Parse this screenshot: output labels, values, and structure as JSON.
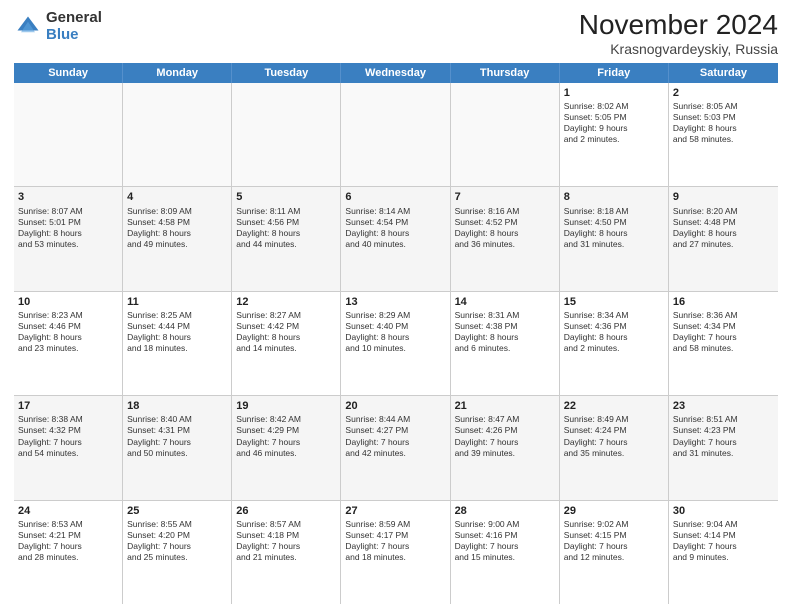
{
  "header": {
    "logo_general": "General",
    "logo_blue": "Blue",
    "title": "November 2024",
    "subtitle": "Krasnogvardeyskiy, Russia"
  },
  "days": [
    "Sunday",
    "Monday",
    "Tuesday",
    "Wednesday",
    "Thursday",
    "Friday",
    "Saturday"
  ],
  "weeks": [
    [
      {
        "day": "",
        "empty": true
      },
      {
        "day": "",
        "empty": true
      },
      {
        "day": "",
        "empty": true
      },
      {
        "day": "",
        "empty": true
      },
      {
        "day": "",
        "empty": true
      },
      {
        "day": "1",
        "lines": [
          "Sunrise: 8:02 AM",
          "Sunset: 5:05 PM",
          "Daylight: 9 hours",
          "and 2 minutes."
        ]
      },
      {
        "day": "2",
        "lines": [
          "Sunrise: 8:05 AM",
          "Sunset: 5:03 PM",
          "Daylight: 8 hours",
          "and 58 minutes."
        ]
      }
    ],
    [
      {
        "day": "3",
        "lines": [
          "Sunrise: 8:07 AM",
          "Sunset: 5:01 PM",
          "Daylight: 8 hours",
          "and 53 minutes."
        ]
      },
      {
        "day": "4",
        "lines": [
          "Sunrise: 8:09 AM",
          "Sunset: 4:58 PM",
          "Daylight: 8 hours",
          "and 49 minutes."
        ]
      },
      {
        "day": "5",
        "lines": [
          "Sunrise: 8:11 AM",
          "Sunset: 4:56 PM",
          "Daylight: 8 hours",
          "and 44 minutes."
        ]
      },
      {
        "day": "6",
        "lines": [
          "Sunrise: 8:14 AM",
          "Sunset: 4:54 PM",
          "Daylight: 8 hours",
          "and 40 minutes."
        ]
      },
      {
        "day": "7",
        "lines": [
          "Sunrise: 8:16 AM",
          "Sunset: 4:52 PM",
          "Daylight: 8 hours",
          "and 36 minutes."
        ]
      },
      {
        "day": "8",
        "lines": [
          "Sunrise: 8:18 AM",
          "Sunset: 4:50 PM",
          "Daylight: 8 hours",
          "and 31 minutes."
        ]
      },
      {
        "day": "9",
        "lines": [
          "Sunrise: 8:20 AM",
          "Sunset: 4:48 PM",
          "Daylight: 8 hours",
          "and 27 minutes."
        ]
      }
    ],
    [
      {
        "day": "10",
        "lines": [
          "Sunrise: 8:23 AM",
          "Sunset: 4:46 PM",
          "Daylight: 8 hours",
          "and 23 minutes."
        ]
      },
      {
        "day": "11",
        "lines": [
          "Sunrise: 8:25 AM",
          "Sunset: 4:44 PM",
          "Daylight: 8 hours",
          "and 18 minutes."
        ]
      },
      {
        "day": "12",
        "lines": [
          "Sunrise: 8:27 AM",
          "Sunset: 4:42 PM",
          "Daylight: 8 hours",
          "and 14 minutes."
        ]
      },
      {
        "day": "13",
        "lines": [
          "Sunrise: 8:29 AM",
          "Sunset: 4:40 PM",
          "Daylight: 8 hours",
          "and 10 minutes."
        ]
      },
      {
        "day": "14",
        "lines": [
          "Sunrise: 8:31 AM",
          "Sunset: 4:38 PM",
          "Daylight: 8 hours",
          "and 6 minutes."
        ]
      },
      {
        "day": "15",
        "lines": [
          "Sunrise: 8:34 AM",
          "Sunset: 4:36 PM",
          "Daylight: 8 hours",
          "and 2 minutes."
        ]
      },
      {
        "day": "16",
        "lines": [
          "Sunrise: 8:36 AM",
          "Sunset: 4:34 PM",
          "Daylight: 7 hours",
          "and 58 minutes."
        ]
      }
    ],
    [
      {
        "day": "17",
        "lines": [
          "Sunrise: 8:38 AM",
          "Sunset: 4:32 PM",
          "Daylight: 7 hours",
          "and 54 minutes."
        ]
      },
      {
        "day": "18",
        "lines": [
          "Sunrise: 8:40 AM",
          "Sunset: 4:31 PM",
          "Daylight: 7 hours",
          "and 50 minutes."
        ]
      },
      {
        "day": "19",
        "lines": [
          "Sunrise: 8:42 AM",
          "Sunset: 4:29 PM",
          "Daylight: 7 hours",
          "and 46 minutes."
        ]
      },
      {
        "day": "20",
        "lines": [
          "Sunrise: 8:44 AM",
          "Sunset: 4:27 PM",
          "Daylight: 7 hours",
          "and 42 minutes."
        ]
      },
      {
        "day": "21",
        "lines": [
          "Sunrise: 8:47 AM",
          "Sunset: 4:26 PM",
          "Daylight: 7 hours",
          "and 39 minutes."
        ]
      },
      {
        "day": "22",
        "lines": [
          "Sunrise: 8:49 AM",
          "Sunset: 4:24 PM",
          "Daylight: 7 hours",
          "and 35 minutes."
        ]
      },
      {
        "day": "23",
        "lines": [
          "Sunrise: 8:51 AM",
          "Sunset: 4:23 PM",
          "Daylight: 7 hours",
          "and 31 minutes."
        ]
      }
    ],
    [
      {
        "day": "24",
        "lines": [
          "Sunrise: 8:53 AM",
          "Sunset: 4:21 PM",
          "Daylight: 7 hours",
          "and 28 minutes."
        ]
      },
      {
        "day": "25",
        "lines": [
          "Sunrise: 8:55 AM",
          "Sunset: 4:20 PM",
          "Daylight: 7 hours",
          "and 25 minutes."
        ]
      },
      {
        "day": "26",
        "lines": [
          "Sunrise: 8:57 AM",
          "Sunset: 4:18 PM",
          "Daylight: 7 hours",
          "and 21 minutes."
        ]
      },
      {
        "day": "27",
        "lines": [
          "Sunrise: 8:59 AM",
          "Sunset: 4:17 PM",
          "Daylight: 7 hours",
          "and 18 minutes."
        ]
      },
      {
        "day": "28",
        "lines": [
          "Sunrise: 9:00 AM",
          "Sunset: 4:16 PM",
          "Daylight: 7 hours",
          "and 15 minutes."
        ]
      },
      {
        "day": "29",
        "lines": [
          "Sunrise: 9:02 AM",
          "Sunset: 4:15 PM",
          "Daylight: 7 hours",
          "and 12 minutes."
        ]
      },
      {
        "day": "30",
        "lines": [
          "Sunrise: 9:04 AM",
          "Sunset: 4:14 PM",
          "Daylight: 7 hours",
          "and 9 minutes."
        ]
      }
    ]
  ]
}
